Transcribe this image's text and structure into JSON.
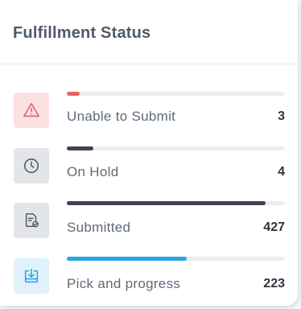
{
  "card": {
    "title": "Fulfillment Status"
  },
  "rows": [
    {
      "label": "Unable to Submit",
      "count": "3",
      "progress": 0.06,
      "bar_color": "#f0605f",
      "icon": "warning-triangle-icon",
      "icon_bg": "#fbe1e1",
      "icon_color": "#e45a5a"
    },
    {
      "label": "On Hold",
      "count": "4",
      "progress": 0.12,
      "bar_color": "#3d4552",
      "icon": "clock-icon",
      "icon_bg": "#e3e5e8",
      "icon_color": "#4a5260"
    },
    {
      "label": "Submitted",
      "count": "427",
      "progress": 0.91,
      "bar_color": "#3d4552",
      "icon": "document-check-icon",
      "icon_bg": "#e3e5e8",
      "icon_color": "#4a5260"
    },
    {
      "label": "Pick and progress",
      "count": "223",
      "progress": 0.55,
      "bar_color": "#29a8e0",
      "icon": "download-tray-icon",
      "icon_bg": "#dff1fa",
      "icon_color": "#2a9fd6"
    }
  ]
}
